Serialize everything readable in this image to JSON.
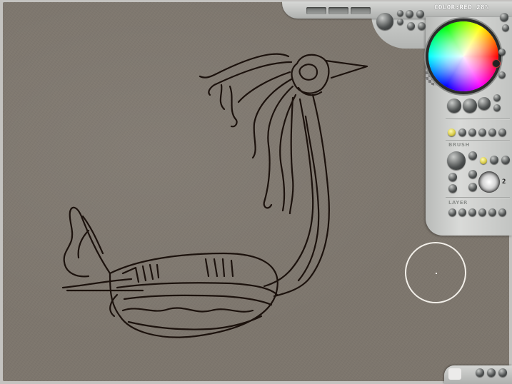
{
  "app": {
    "color_label": "COLOR:RED 28%"
  },
  "palette": {
    "wheel_hue_ring": "conic hue ring",
    "current_color": "#222222"
  },
  "sections": {
    "brush_label": "BRUSH",
    "layer_label": "LAYER"
  },
  "brush": {
    "size_value": "2"
  },
  "colors": {
    "canvas": "#7d766d",
    "panel": "#c8cac8",
    "ink": "#1c120d",
    "cursor_ring": "#f2efe9",
    "lit_knob": "#e0d24f"
  },
  "icons": {
    "slot": "toolbar-slot",
    "knob": "round-button",
    "cursor": "brush-cursor-ring",
    "signature": "signature-icon"
  }
}
